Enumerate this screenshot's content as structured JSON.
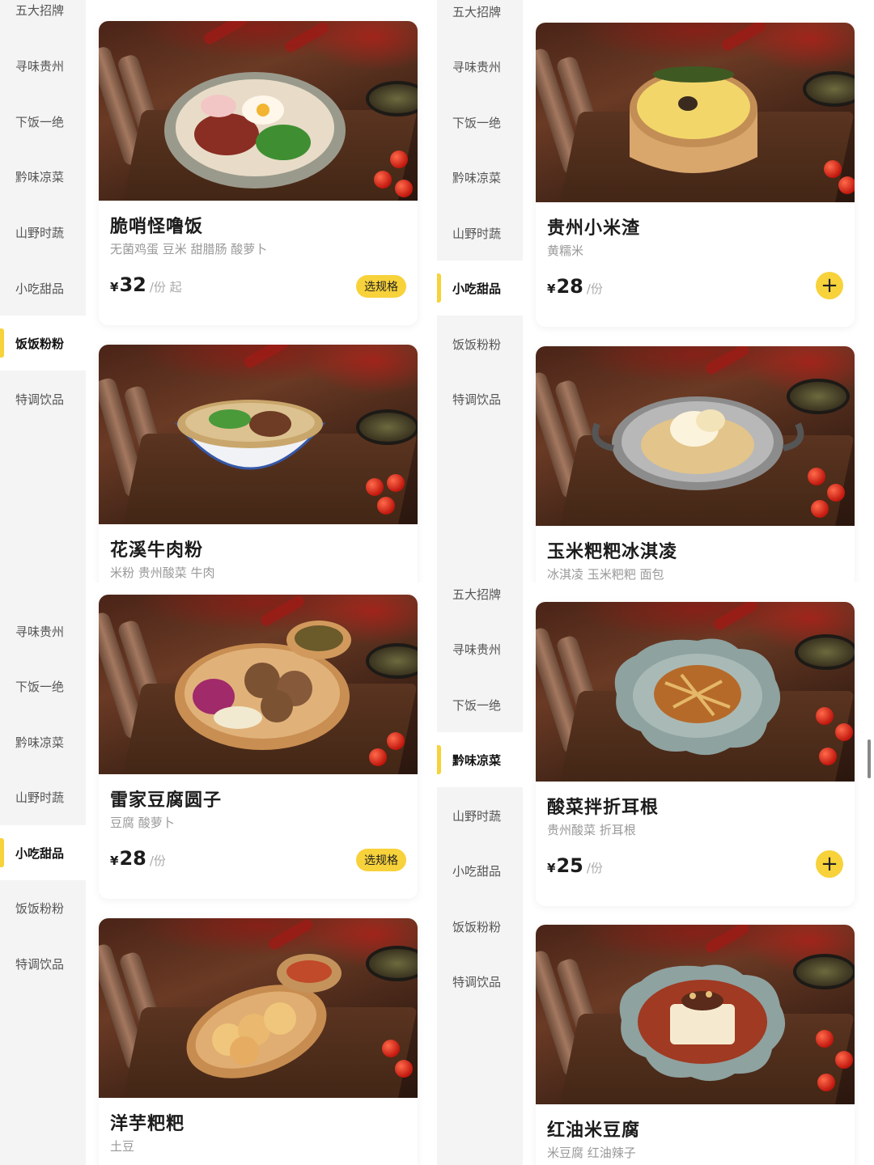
{
  "categories": [
    "五大招牌",
    "寻味贵州",
    "下饭一绝",
    "黔味凉菜",
    "山野时蔬",
    "小吃甜品",
    "饭饭粉粉",
    "特调饮品"
  ],
  "left_top": {
    "active": "饭饭粉粉",
    "cards": [
      {
        "name": "脆哨怪噜饭",
        "desc": "无菌鸡蛋 豆米 甜腊肠 酸萝卜",
        "currency": "¥",
        "price": "32",
        "unit": "/份 起",
        "button": "选规格"
      },
      {
        "name": "花溪牛肉粉",
        "desc": "米粉 贵州酸菜 牛肉"
      }
    ]
  },
  "left_bottom": {
    "active": "小吃甜品",
    "cards": [
      {
        "name": "雷家豆腐圆子",
        "desc": "豆腐 酸萝卜",
        "currency": "¥",
        "price": "28",
        "unit": "/份",
        "button": "选规格"
      },
      {
        "name": "洋芋粑粑",
        "desc": "土豆"
      }
    ]
  },
  "right_top": {
    "active": "小吃甜品",
    "cards": [
      {
        "name": "贵州小米渣",
        "desc": "黄糯米",
        "currency": "¥",
        "price": "28",
        "unit": "/份",
        "button": "+"
      },
      {
        "name": "玉米粑粑冰淇凌",
        "desc": "冰淇凌 玉米粑粑 面包"
      }
    ]
  },
  "right_bottom": {
    "active": "黔味凉菜",
    "cards": [
      {
        "name": "酸菜拌折耳根",
        "desc": "贵州酸菜 折耳根",
        "currency": "¥",
        "price": "25",
        "unit": "/份",
        "button": "+"
      },
      {
        "name": "红油米豆腐",
        "desc": "米豆腐 红油辣子"
      }
    ]
  },
  "colors": {
    "accent": "#f7d23a",
    "sidebar_bg": "#f4f4f4"
  }
}
